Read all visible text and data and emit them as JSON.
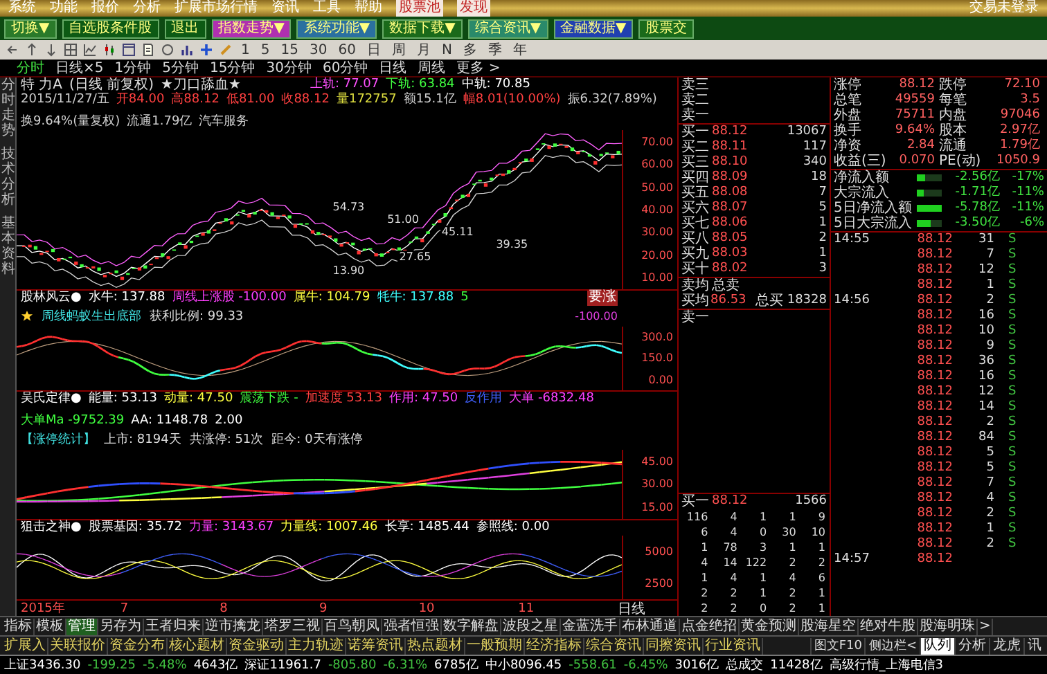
{
  "menu_bar": {
    "items": [
      {
        "label": "系统",
        "highlight": false
      },
      {
        "label": "功能",
        "highlight": false
      },
      {
        "label": "报价",
        "highlight": false
      },
      {
        "label": "分析",
        "highlight": false
      },
      {
        "label": "扩展市场行情",
        "highlight": false
      },
      {
        "label": "资讯",
        "highlight": false
      },
      {
        "label": "工具",
        "highlight": false
      },
      {
        "label": "帮助",
        "highlight": false
      },
      {
        "label": "股票池",
        "highlight": true
      },
      {
        "label": "发现",
        "highlight": true
      }
    ],
    "account": "交易未登录"
  },
  "toolbar": {
    "buttons": [
      {
        "label": "切换▼",
        "color": "#2a7a2a"
      },
      {
        "label": "自选股条件股",
        "color": "#0d5a14"
      },
      {
        "label": "退出",
        "color": "#0d5a14"
      },
      {
        "label": "指数走势▼",
        "color": "#b030b0"
      },
      {
        "label": "系统功能▼",
        "color": "#2a70a0"
      },
      {
        "label": "数据下载▼",
        "color": "#1a6a1a"
      },
      {
        "label": "综合资讯▼",
        "color": "#2a8a6a"
      },
      {
        "label": "金融数据▼",
        "color": "#2040b0"
      },
      {
        "label": "股票交",
        "color": "#1a6a1a"
      }
    ]
  },
  "icon_toolbar": {
    "periods": [
      "1",
      "5",
      "15",
      "30",
      "60",
      "日",
      "周",
      "月",
      "N",
      "多",
      "季",
      "年"
    ]
  },
  "period_tabs": [
    {
      "label": "分时",
      "selected": true
    },
    {
      "label": "日线×5",
      "selected": false
    },
    {
      "label": "1分钟",
      "selected": false
    },
    {
      "label": "5分钟",
      "selected": false
    },
    {
      "label": "15分钟",
      "selected": false
    },
    {
      "label": "30分钟",
      "selected": false
    },
    {
      "label": "60分钟",
      "selected": false
    },
    {
      "label": "日线",
      "selected": false
    },
    {
      "label": "周线",
      "selected": false
    },
    {
      "label": "更多 >",
      "selected": false
    }
  ],
  "side_tabs": [
    "分时走势",
    "技术分析",
    "基本资料"
  ],
  "chart": {
    "title": {
      "name": "特 力A",
      "period": "(日线 前复权)",
      "formula": "★刀口舔血★",
      "bands": [
        {
          "text": "上轨: 77.07",
          "color": "#ff50ff"
        },
        {
          "text": "下轨: 63.84",
          "color": "#40ff40"
        },
        {
          "text": "中轨: 70.85",
          "color": "#ffffff"
        }
      ]
    },
    "info": [
      {
        "text": "2015/11/27/五",
        "color": "#d0d0d0"
      },
      {
        "text": "开84.00",
        "color": "#ff4040"
      },
      {
        "text": "高88.12",
        "color": "#ff4040"
      },
      {
        "text": "低81.00",
        "color": "#ff4040"
      },
      {
        "text": "收88.12",
        "color": "#ff4040"
      },
      {
        "text": "量172757",
        "color": "#e0e040"
      },
      {
        "text": "额15.1亿",
        "color": "#d0d0d0"
      },
      {
        "text": "幅8.01(10.00%)",
        "color": "#ff4040"
      },
      {
        "text": "振6.32(7.89%)",
        "color": "#d0d0d0"
      },
      {
        "text": "换9.64%(量复权)",
        "color": "#d0d0d0"
      },
      {
        "text": "流通1.79亿",
        "color": "#d0d0d0"
      },
      {
        "text": "汽车服务",
        "color": "#d0d0d0"
      }
    ],
    "price_labels": [
      "54.73",
      "51.00",
      "45.11",
      "39.35",
      "27.65",
      "13.90"
    ],
    "axis": [
      "70.00",
      "60.00",
      "50.00",
      "40.00",
      "30.00",
      "20.00",
      "10.00"
    ],
    "panels": [
      {
        "kind": "oscillator",
        "header": [
          {
            "text": "股林风云●",
            "color": "#ffffff"
          },
          {
            "text": "水牛: 137.88",
            "color": "#ffffff"
          },
          {
            "text": "周线上涨股 -100.00",
            "color": "#ff40ff"
          },
          {
            "text": "属牛: 104.79",
            "color": "#ffff40"
          },
          {
            "text": "牦牛: 137.88",
            "color": "#40ffff"
          },
          {
            "text": "5",
            "color": "#40ff40"
          }
        ],
        "notes": [
          "周线蚂蚁生出底部",
          "获利比例: 99.33"
        ],
        "badge": "要涨",
        "side_value": "-100.00",
        "axis": [
          "300.0",
          "150.0",
          "0.00"
        ]
      },
      {
        "kind": "trend",
        "header": [
          {
            "text": "吴氏定律●",
            "color": "#ffffff"
          },
          {
            "text": "能量: 53.13",
            "color": "#ffffff"
          },
          {
            "text": "动量: 47.50",
            "color": "#ffff40"
          },
          {
            "text": "震荡下跌 -",
            "color": "#40ff40"
          },
          {
            "text": "加速度 53.13",
            "color": "#ff4040"
          },
          {
            "text": "作用: 47.50",
            "color": "#ff40ff"
          },
          {
            "text": "反作用",
            "color": "#4060ff"
          },
          {
            "text": "大单 -6832.48",
            "color": "#ff40ff"
          },
          {
            "text": "大单Ma -9752.39",
            "color": "#40ff40"
          },
          {
            "text": "AA: 1148.78",
            "color": "#ffffff"
          },
          {
            "text": "2.00",
            "color": "#ffffff"
          }
        ],
        "notes": [
          "【涨停统计】",
          "上市: 8194天",
          "共涨停: 51次",
          "距今: 0天有涨停"
        ],
        "axis": [
          "45.00",
          "30.00",
          "15.00"
        ]
      },
      {
        "kind": "sniper",
        "header": [
          {
            "text": "狙击之神●",
            "color": "#ffffff"
          },
          {
            "text": "股票基因: 35.72",
            "color": "#ffffff"
          },
          {
            "text": "力量: 3143.67",
            "color": "#ff40ff"
          },
          {
            "text": "力量线: 1007.46",
            "color": "#ffff40"
          },
          {
            "text": "长享: 1485.44",
            "color": "#ffffff"
          },
          {
            "text": "参照线: 0.00",
            "color": "#ffffff"
          }
        ],
        "axis": [
          "5000",
          "2500"
        ]
      }
    ],
    "x_axis": [
      "2015年",
      "7",
      "8",
      "9",
      "10",
      "11"
    ],
    "x_axis_period": "日线"
  },
  "order_book": {
    "asks": [
      "卖三",
      "卖二",
      "卖一"
    ],
    "bids": [
      {
        "label": "买一",
        "price": "88.12",
        "volume": "13067"
      },
      {
        "label": "买二",
        "price": "88.11",
        "volume": "117"
      },
      {
        "label": "买三",
        "price": "88.10",
        "volume": "340"
      },
      {
        "label": "买四",
        "price": "88.09",
        "volume": "18"
      },
      {
        "label": "买五",
        "price": "88.08",
        "volume": "7"
      },
      {
        "label": "买六",
        "price": "88.07",
        "volume": "5"
      },
      {
        "label": "买七",
        "price": "88.06",
        "volume": "1"
      },
      {
        "label": "买八",
        "price": "88.05",
        "volume": "2"
      },
      {
        "label": "买九",
        "price": "88.03",
        "volume": "1"
      },
      {
        "label": "买十",
        "price": "88.02",
        "volume": "3"
      }
    ],
    "avg_ask": {
      "label": "卖均",
      "total_label": "总卖"
    },
    "avg_bid": {
      "label": "买均",
      "price": "86.53",
      "total_label": "总买",
      "total": "18328"
    },
    "queue_sell": "卖一",
    "queue_buy": {
      "label": "买一",
      "price": "88.12",
      "volume": "1566"
    },
    "queue": [
      [
        "116",
        "4",
        "1",
        "1",
        "9"
      ],
      [
        "6",
        "4",
        "0",
        "30",
        "10"
      ],
      [
        "1",
        "78",
        "3",
        "1",
        "1"
      ],
      [
        "4",
        "14",
        "122",
        "2",
        "2"
      ],
      [
        "1",
        "4",
        "1",
        "4",
        "6"
      ],
      [
        "2",
        "2",
        "1",
        "2",
        "1"
      ],
      [
        "2",
        "2",
        "0",
        "2",
        "1"
      ]
    ]
  },
  "stats": [
    {
      "label": "涨停",
      "value": "88.12",
      "label2": "跌停",
      "value2": "72.10"
    },
    {
      "label": "总笔",
      "value": "49559",
      "label2": "每笔",
      "value2": "3.5"
    },
    {
      "label": "外盘",
      "value": "75711",
      "label2": "内盘",
      "value2": "97046"
    },
    {
      "label": "换手",
      "value": "9.64%",
      "label2": "股本",
      "value2": "2.97亿"
    },
    {
      "label": "净资",
      "value": "2.84",
      "label2": "流通",
      "value2": "1.79亿"
    },
    {
      "label": "收益(三)",
      "value": "0.070",
      "label2": "PE(动)",
      "value2": "1050.9"
    }
  ],
  "flows": [
    {
      "label": "净流入额",
      "level": 0.35,
      "value": "-2.56亿",
      "percent": "-17%"
    },
    {
      "label": "大宗流入",
      "level": 0.25,
      "value": "-1.71亿",
      "percent": "-11%"
    },
    {
      "label": "5日净流入额",
      "level": 1,
      "value": "-5.78亿",
      "percent": "-11%"
    },
    {
      "label": "5日大宗流入",
      "level": 0.55,
      "value": "-3.50亿",
      "percent": "-6%"
    }
  ],
  "ticks": [
    {
      "time": "14:55",
      "price": "88.12",
      "volume": "31",
      "side": "S"
    },
    {
      "price": "88.12",
      "volume": "7",
      "side": "S"
    },
    {
      "price": "88.12",
      "volume": "12",
      "side": "S"
    },
    {
      "price": "88.12",
      "volume": "1",
      "side": "S"
    },
    {
      "time": "14:56",
      "price": "88.12",
      "volume": "2",
      "side": "S"
    },
    {
      "price": "88.12",
      "volume": "16",
      "side": "S"
    },
    {
      "price": "88.12",
      "volume": "10",
      "side": "S"
    },
    {
      "price": "88.12",
      "volume": "9",
      "side": "S"
    },
    {
      "price": "88.12",
      "volume": "36",
      "side": "S"
    },
    {
      "price": "88.12",
      "volume": "16",
      "side": "S"
    },
    {
      "price": "88.12",
      "volume": "12",
      "side": "S"
    },
    {
      "price": "88.12",
      "volume": "14",
      "side": "S"
    },
    {
      "price": "88.12",
      "volume": "2",
      "side": "S"
    },
    {
      "price": "88.12",
      "volume": "84",
      "side": "S"
    },
    {
      "price": "88.12",
      "volume": "5",
      "side": "S"
    },
    {
      "price": "88.12",
      "volume": "5",
      "side": "S"
    },
    {
      "price": "88.12",
      "volume": "7",
      "side": "S"
    },
    {
      "price": "88.12",
      "volume": "4",
      "side": "S"
    },
    {
      "price": "88.12",
      "volume": "2",
      "side": "S"
    },
    {
      "price": "88.12",
      "volume": "1",
      "side": "S"
    },
    {
      "price": "88.12",
      "volume": "2",
      "side": "S"
    },
    {
      "time": "14:57",
      "price": "88.12"
    }
  ],
  "indicator_tabs": [
    {
      "label": "指标",
      "selected": false
    },
    {
      "label": "模板",
      "selected": false
    },
    {
      "label": "管理",
      "selected": true
    },
    {
      "label": "另存为",
      "selected": false
    },
    {
      "label": "王者归来",
      "selected": false
    },
    {
      "label": "逆市擒龙",
      "selected": false
    },
    {
      "label": "塔罗三视",
      "selected": false
    },
    {
      "label": "百鸟朝凤",
      "selected": false
    },
    {
      "label": "强者恒强",
      "selected": false
    },
    {
      "label": "数字解盘",
      "selected": false
    },
    {
      "label": "波段之星",
      "selected": false
    },
    {
      "label": "金蓝洗手",
      "selected": false
    },
    {
      "label": "布林通道",
      "selected": false
    },
    {
      "label": "点金绝招",
      "selected": false
    },
    {
      "label": "黄金预测",
      "selected": false
    },
    {
      "label": "股海星空",
      "selected": false
    },
    {
      "label": "绝对牛股",
      "selected": false
    },
    {
      "label": "股海明珠",
      "selected": false
    },
    {
      "label": ">",
      "selected": false
    }
  ],
  "info_tabs": [
    "扩展入",
    "关联报价",
    "资金分布",
    "核心题材",
    "资金驱动",
    "主力轨迹",
    "诺筹资讯",
    "热点题材",
    "一般预期",
    "经济指标",
    "综合资讯",
    "同擦资讯",
    "行业资讯"
  ],
  "side_buttons": [
    "图文F10",
    "侧边栏<"
  ],
  "right_tabs": [
    {
      "label": "队列",
      "selected": true
    },
    {
      "label": "分析",
      "selected": false
    },
    {
      "label": "龙虎",
      "selected": false
    },
    {
      "label": "讯",
      "selected": false
    }
  ],
  "status_bar": [
    {
      "text": "上证3436.30",
      "color": "#ffffff"
    },
    {
      "text": "-199.25",
      "color": "#40c040"
    },
    {
      "text": "-5.48%",
      "color": "#40c040"
    },
    {
      "text": "4643亿",
      "color": "#ffffff"
    },
    {
      "text": "深证11961.7",
      "color": "#ffffff"
    },
    {
      "text": "-805.80",
      "color": "#40c040"
    },
    {
      "text": "-6.31%",
      "color": "#40c040"
    },
    {
      "text": "6785亿",
      "color": "#ffffff"
    },
    {
      "text": "中小8096.45",
      "color": "#ffffff"
    },
    {
      "text": "-558.61",
      "color": "#40c040"
    },
    {
      "text": "-6.45%",
      "color": "#40c040"
    },
    {
      "text": "3016亿",
      "color": "#ffffff"
    },
    {
      "text": "总成交",
      "color": "#ffffff"
    },
    {
      "text": "11428亿",
      "color": "#ffffff"
    },
    {
      "text": "高级行情_上海电信3",
      "color": "#ffffff"
    }
  ]
}
